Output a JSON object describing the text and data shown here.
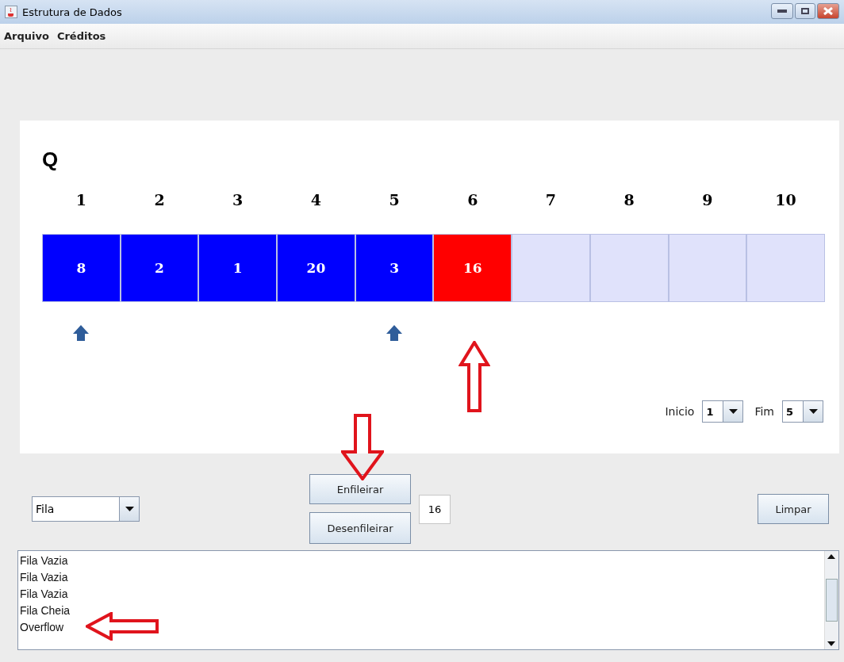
{
  "window": {
    "title": "Estrutura de Dados"
  },
  "menu": [
    "Arquivo",
    "Créditos"
  ],
  "queue": {
    "title": "Q",
    "cells": [
      {
        "index": "1",
        "value": "8",
        "color": "#0000ff",
        "pointer": true
      },
      {
        "index": "2",
        "value": "2",
        "color": "#0000ff",
        "pointer": false
      },
      {
        "index": "3",
        "value": "1",
        "color": "#0000ff",
        "pointer": false
      },
      {
        "index": "4",
        "value": "20",
        "color": "#0000ff",
        "pointer": false
      },
      {
        "index": "5",
        "value": "3",
        "color": "#0000ff",
        "pointer": true
      },
      {
        "index": "6",
        "value": "16",
        "color": "#ff0000",
        "pointer": false
      },
      {
        "index": "7",
        "color": "#e0e2fb",
        "pointer": false
      },
      {
        "index": "8",
        "color": "#e0e2fb",
        "pointer": false
      },
      {
        "index": "9",
        "color": "#e0e2fb",
        "pointer": false
      },
      {
        "index": "10",
        "color": "#e0e2fb",
        "pointer": false
      }
    ],
    "start": {
      "label": "Inicio",
      "value": "1"
    },
    "end": {
      "label": "Fim",
      "value": "5"
    }
  },
  "structure_select": {
    "value": "Fila"
  },
  "buttons": {
    "enqueue": "Enfileirar",
    "dequeue": "Desenfileirar",
    "clear": "Limpar"
  },
  "value_field": {
    "value": "16"
  },
  "log": [
    "Fila Vazia",
    "Fila Vazia",
    "Fila Vazia",
    "Fila Cheia",
    "Overflow"
  ]
}
